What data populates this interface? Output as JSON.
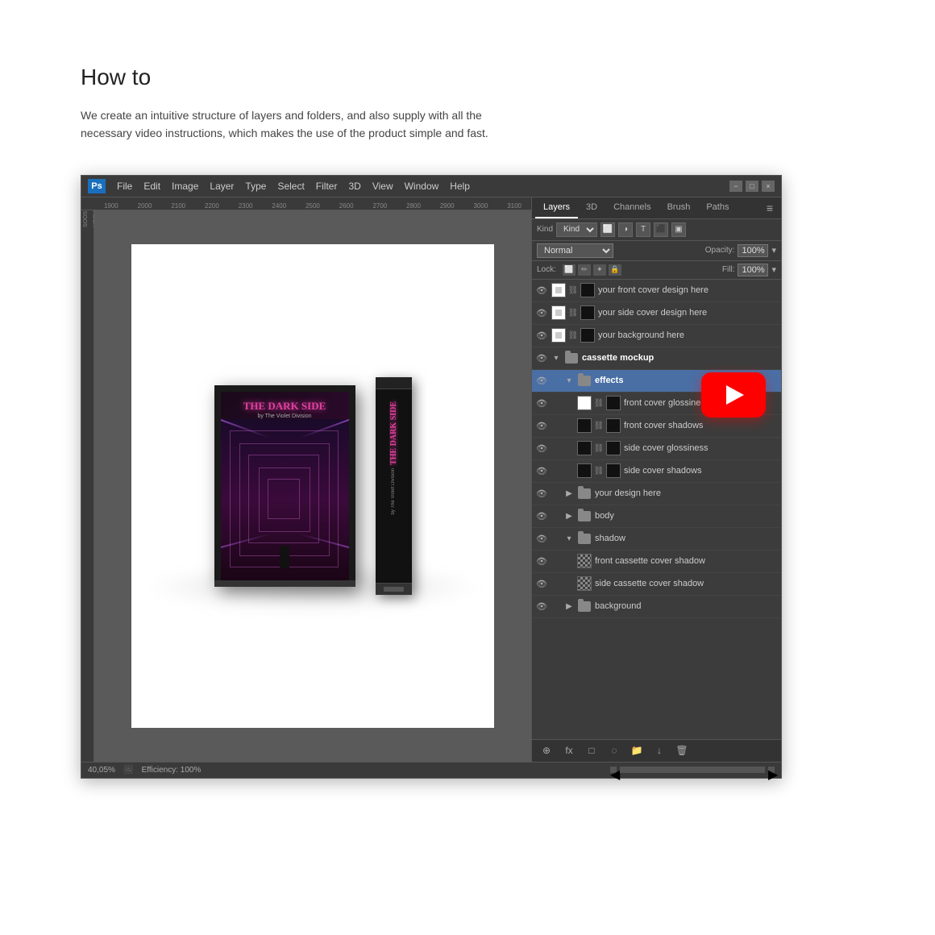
{
  "page": {
    "title": "How to",
    "description": "We create an intuitive structure of layers and folders, and also supply with all the necessary video instructions, which makes the use of the product simple and fast."
  },
  "photoshop": {
    "logo": "Ps",
    "menu_items": [
      "File",
      "Edit",
      "Image",
      "Layer",
      "Type",
      "Select",
      "Filter",
      "3D",
      "View",
      "Window",
      "Help"
    ],
    "window_controls": [
      "−",
      "□",
      "×"
    ],
    "statusbar": {
      "zoom": "40,05%",
      "efficiency": "Efficiency: 100%"
    },
    "panels": {
      "tabs": [
        "Layers",
        "3D",
        "Channels",
        "Brush",
        "Paths"
      ],
      "active_tab": "Layers",
      "kind_label": "Kind",
      "blend_mode": "Normal",
      "opacity_label": "Opacity:",
      "opacity_value": "100%",
      "fill_label": "Fill:",
      "fill_value": "100%",
      "lock_label": "Lock:"
    },
    "layers": [
      {
        "id": 1,
        "indent": 0,
        "type": "layer",
        "name": "your front cover design here",
        "visible": true,
        "selected": false
      },
      {
        "id": 2,
        "indent": 0,
        "type": "layer",
        "name": "your side cover design here",
        "visible": true,
        "selected": false
      },
      {
        "id": 3,
        "indent": 0,
        "type": "layer",
        "name": "your background here",
        "visible": true,
        "selected": false
      },
      {
        "id": 4,
        "indent": 0,
        "type": "folder",
        "name": "cassette mockup",
        "visible": true,
        "selected": false,
        "expanded": true
      },
      {
        "id": 5,
        "indent": 1,
        "type": "folder",
        "name": "effects",
        "visible": true,
        "selected": true,
        "expanded": true
      },
      {
        "id": 6,
        "indent": 2,
        "type": "layer",
        "name": "front cover glossiness",
        "visible": true,
        "selected": false
      },
      {
        "id": 7,
        "indent": 2,
        "type": "layer",
        "name": "front cover shadows",
        "visible": true,
        "selected": false
      },
      {
        "id": 8,
        "indent": 2,
        "type": "layer",
        "name": "side cover glossiness",
        "visible": true,
        "selected": false
      },
      {
        "id": 9,
        "indent": 2,
        "type": "layer",
        "name": "side cover shadows",
        "visible": true,
        "selected": false
      },
      {
        "id": 10,
        "indent": 1,
        "type": "folder",
        "name": "your design here",
        "visible": true,
        "selected": false,
        "expanded": false
      },
      {
        "id": 11,
        "indent": 1,
        "type": "folder",
        "name": "body",
        "visible": true,
        "selected": false,
        "expanded": false
      },
      {
        "id": 12,
        "indent": 1,
        "type": "folder",
        "name": "shadow",
        "visible": true,
        "selected": false,
        "expanded": true
      },
      {
        "id": 13,
        "indent": 2,
        "type": "layer_checker",
        "name": "front cassette cover shadow",
        "visible": true,
        "selected": false
      },
      {
        "id": 14,
        "indent": 2,
        "type": "layer_checker",
        "name": "side cassette cover shadow",
        "visible": true,
        "selected": false
      },
      {
        "id": 15,
        "indent": 1,
        "type": "folder",
        "name": "background",
        "visible": true,
        "selected": false,
        "expanded": false
      }
    ],
    "bottom_icons": [
      "⊕",
      "fx",
      "□",
      "◌",
      "📁",
      "↓",
      "🗑"
    ]
  },
  "cassette": {
    "title_line1": "THE DARK SIDE",
    "subtitle": "by The Violet Division",
    "side_title": "THE DARK SIDE",
    "side_subtitle": "by The Violet Division"
  },
  "ruler": {
    "ticks": [
      "1900",
      "2000",
      "2100",
      "2200",
      "2300",
      "2400",
      "2500",
      "2600",
      "2700",
      "2800",
      "2900",
      "3000",
      "3100"
    ]
  }
}
